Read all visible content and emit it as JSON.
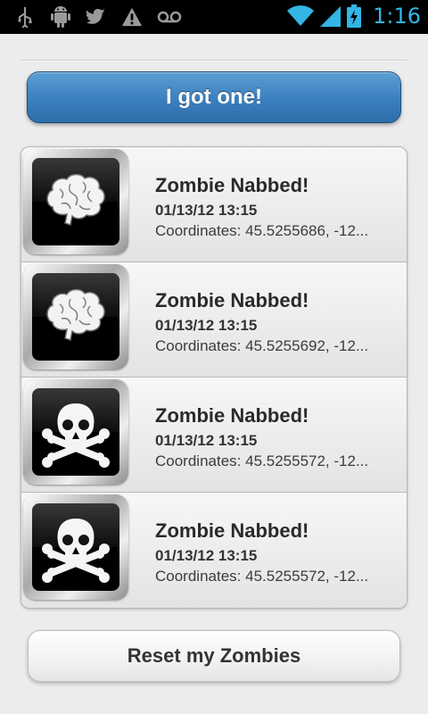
{
  "status_bar": {
    "left_icons": [
      "usb-icon",
      "android-debug-icon",
      "twitter-icon",
      "warning-icon",
      "voicemail-icon"
    ],
    "right_icons": [
      "wifi-icon",
      "signal-icon",
      "battery-charging-icon"
    ],
    "time": "1:16",
    "time_color": "#33b5e5"
  },
  "primary_button": {
    "label": "I got one!",
    "color": "#3a7fbe"
  },
  "list": {
    "items": [
      {
        "icon": "brain-icon",
        "title": "Zombie Nabbed!",
        "date": "01/13/12 13:15",
        "coords": "Coordinates: 45.5255686, -12..."
      },
      {
        "icon": "brain-icon",
        "title": "Zombie Nabbed!",
        "date": "01/13/12 13:15",
        "coords": "Coordinates: 45.5255692, -12..."
      },
      {
        "icon": "skull-crossbones-icon",
        "title": "Zombie Nabbed!",
        "date": "01/13/12 13:15",
        "coords": "Coordinates: 45.5255572, -12..."
      },
      {
        "icon": "skull-crossbones-icon",
        "title": "Zombie Nabbed!",
        "date": "01/13/12 13:15",
        "coords": "Coordinates: 45.5255572, -12..."
      }
    ]
  },
  "secondary_button": {
    "label": "Reset my Zombies"
  }
}
